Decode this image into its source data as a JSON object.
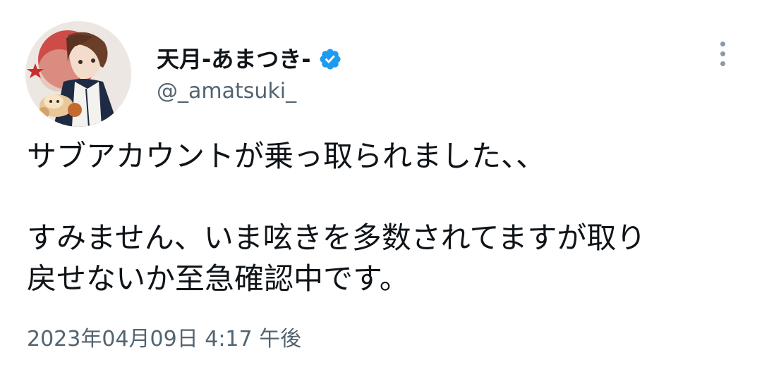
{
  "author": {
    "display_name": "天月-あまつき-",
    "handle": "@_amatsuki_",
    "verified": true,
    "verified_color": "#1d9bf0",
    "avatar_icon": "user-avatar-illustration"
  },
  "tweet": {
    "lines": [
      "サブアカウントが乗っ取られました、、",
      "",
      "すみません、いま呟きを多数されてますが取り",
      "戻せないか至急確認中です。"
    ],
    "timestamp": "2023年04月09日 4:17 午後"
  },
  "menu": {
    "icon": "more-vertical-icon"
  },
  "colors": {
    "text_primary": "#0f1419",
    "text_secondary": "#536471",
    "background": "#ffffff"
  }
}
